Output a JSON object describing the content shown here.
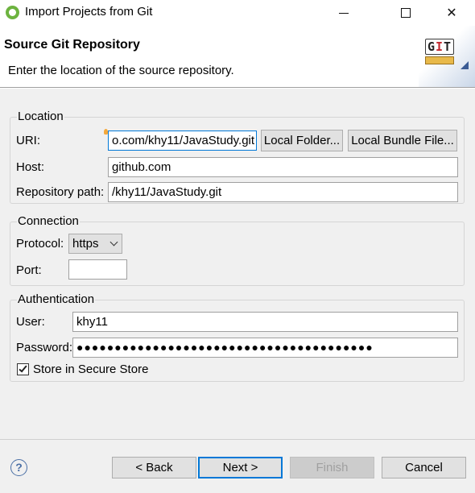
{
  "window": {
    "title": "Import Projects from Git",
    "minimize_icon": "minimize-icon",
    "maximize_icon": "maximize-icon",
    "close_icon": "close-icon",
    "close_glyph": "✕"
  },
  "header": {
    "title": "Source Git Repository",
    "description": "Enter the location of the source repository.",
    "logo_text": "GIT"
  },
  "location": {
    "group_title": "Location",
    "uri_label": "URI:",
    "uri_value": "o.com/khy11/JavaStudy.git",
    "local_folder_button": "Local Folder...",
    "local_bundle_button": "Local Bundle File...",
    "host_label": "Host:",
    "host_value": "github.com",
    "repo_path_label": "Repository path:",
    "repo_path_value": "/khy11/JavaStudy.git"
  },
  "connection": {
    "group_title": "Connection",
    "protocol_label": "Protocol:",
    "protocol_value": "https",
    "port_label": "Port:",
    "port_value": ""
  },
  "authentication": {
    "group_title": "Authentication",
    "user_label": "User:",
    "user_value": "khy11",
    "password_label": "Password:",
    "password_mask": "●●●●●●●●●●●●●●●●●●●●●●●●●●●●●●●●●●●●●●●",
    "store_label": "Store in Secure Store",
    "store_checked": true
  },
  "footer": {
    "help_glyph": "?",
    "back_button": "< Back",
    "next_button": "Next >",
    "finish_button": "Finish",
    "cancel_button": "Cancel"
  }
}
